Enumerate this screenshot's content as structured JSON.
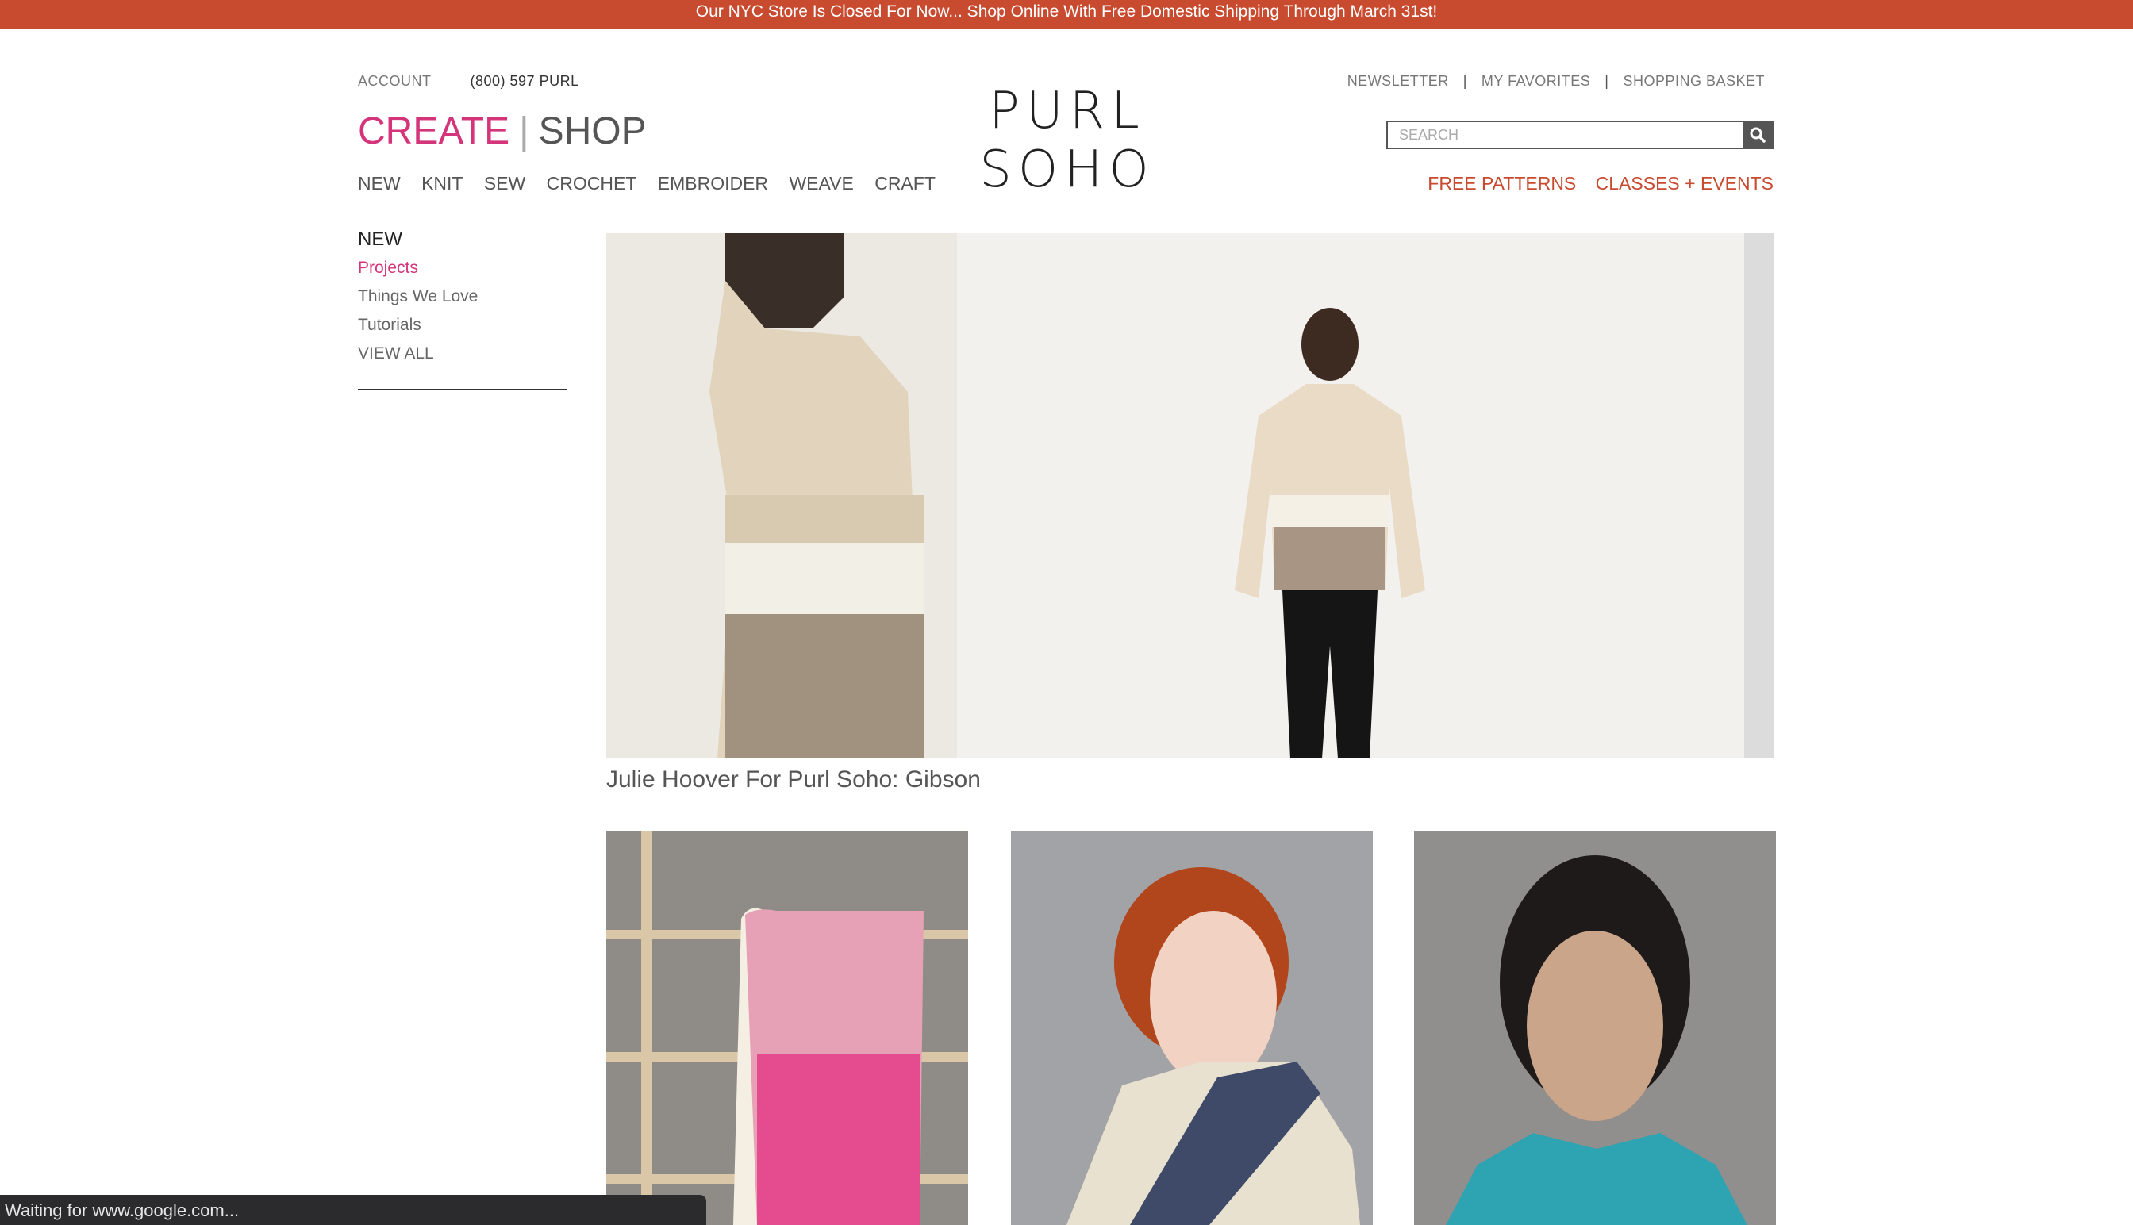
{
  "announcement": "Our NYC Store Is Closed For Now... Shop Online With Free Domestic Shipping Through March 31st!",
  "header": {
    "account": "ACCOUNT",
    "phone": "(800) 597 PURL",
    "brand": "PURL SOHO",
    "right_links": [
      "NEWSLETTER",
      "MY FAVORITES",
      "SHOPPING BASKET"
    ],
    "search_placeholder": "SEARCH",
    "tab_create": "CREATE",
    "tab_separator": "|",
    "tab_shop": "SHOP",
    "main_nav": [
      "NEW",
      "KNIT",
      "SEW",
      "CROCHET",
      "EMBROIDER",
      "WEAVE",
      "CRAFT"
    ],
    "promo_links": [
      "FREE PATTERNS",
      "CLASSES + EVENTS"
    ]
  },
  "sidebar": {
    "heading": "NEW",
    "items": [
      "Projects",
      "Things We Love",
      "Tutorials",
      "VIEW ALL"
    ]
  },
  "hero": {
    "caption": "Julie Hoover For Purl Soho: Gibson"
  },
  "status_bar": "Waiting for www.google.com...",
  "colors": {
    "announcement_bg": "#c84a2f",
    "accent_pink": "#d4347a",
    "accent_orange": "#c84a2f"
  }
}
